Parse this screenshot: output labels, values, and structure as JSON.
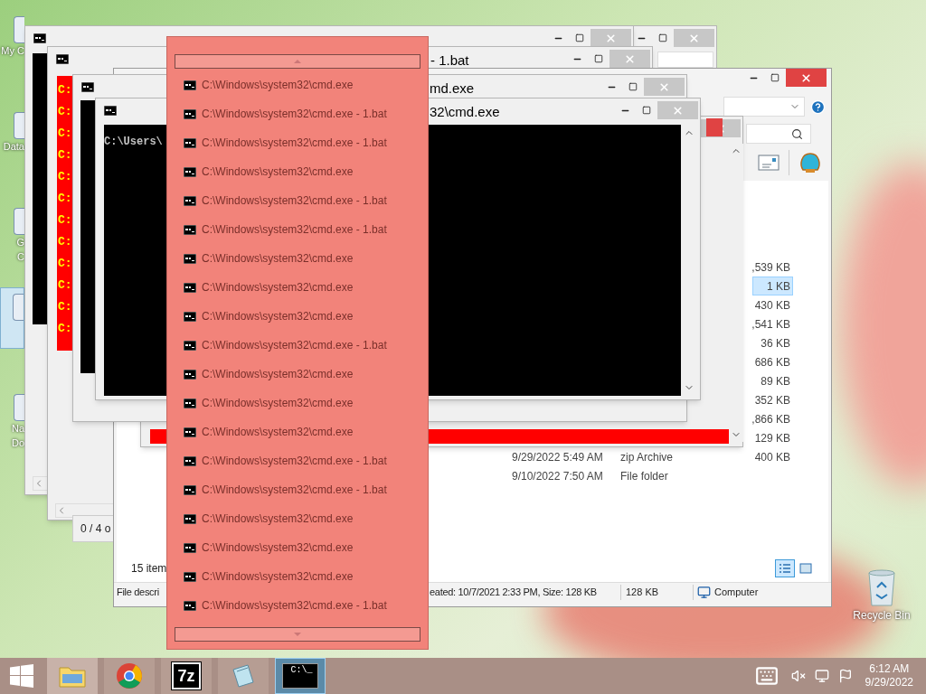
{
  "desktop_icons": [
    {
      "lines": [
        "My C"
      ],
      "selected": false
    },
    {
      "lines": [
        "Data"
      ],
      "selected": false
    },
    {
      "lines": [
        "G",
        "C"
      ],
      "selected": false
    },
    {
      "selected": true
    },
    {
      "lines": [
        "Na",
        "Do"
      ],
      "selected": false
    }
  ],
  "recycle_bin": {
    "label": "Recycle Bin"
  },
  "cmd_windows": [
    {
      "color": "#000000"
    },
    {
      "title": "- 1.bat",
      "color": "#ff0000",
      "lines": [
        "C:",
        "C:",
        "C:",
        "C:",
        "C:",
        "C:",
        "C:",
        "C:",
        "C:",
        "C:",
        "C:",
        "C:"
      ]
    },
    {
      "color": "#ff0000"
    },
    {
      "title": "md.exe",
      "color": "#000000"
    },
    {
      "title": "32\\cmd.exe",
      "color": "#000000",
      "lines": [
        "C:\\Users\\"
      ]
    }
  ],
  "status_window": {
    "text": "0 / 4 o"
  },
  "explorer": {
    "rows": [
      {
        "size": ",539 KB",
        "selected": false
      },
      {
        "size": "1 KB",
        "selected": true
      },
      {
        "size": "430 KB",
        "selected": false
      },
      {
        "size": ",541 KB",
        "selected": false
      },
      {
        "size": "36 KB",
        "selected": false
      },
      {
        "size": "686 KB",
        "selected": false
      },
      {
        "size": "89 KB",
        "selected": false
      },
      {
        "size": "352 KB",
        "selected": false
      },
      {
        "size": ",866 KB",
        "selected": false
      },
      {
        "size": "129 KB",
        "selected": false
      },
      {
        "date": "9/29/2022 5:49 AM",
        "type": "zip Archive",
        "size": "400 KB",
        "selected": false
      },
      {
        "date": "9/10/2022 7:50 AM",
        "type": "File folder",
        "selected": false
      }
    ],
    "item_count": "15 item",
    "views": [
      {
        "kind": "details",
        "selected": true
      },
      {
        "kind": "preview",
        "selected": false
      }
    ],
    "status_bar": [
      "File descri",
      "eated: 10/7/2021 2:33 PM, Size: 128 KB",
      "128 KB",
      "Computer"
    ]
  },
  "switcher": {
    "items": [
      {
        "label": "C:\\Windows\\system32\\cmd.exe"
      },
      {
        "label": "C:\\Windows\\system32\\cmd.exe - 1.bat"
      },
      {
        "label": "C:\\Windows\\system32\\cmd.exe - 1.bat"
      },
      {
        "label": "C:\\Windows\\system32\\cmd.exe"
      },
      {
        "label": "C:\\Windows\\system32\\cmd.exe - 1.bat"
      },
      {
        "label": "C:\\Windows\\system32\\cmd.exe - 1.bat"
      },
      {
        "label": "C:\\Windows\\system32\\cmd.exe"
      },
      {
        "label": "C:\\Windows\\system32\\cmd.exe"
      },
      {
        "label": "C:\\Windows\\system32\\cmd.exe"
      },
      {
        "label": "C:\\Windows\\system32\\cmd.exe - 1.bat"
      },
      {
        "label": "C:\\Windows\\system32\\cmd.exe"
      },
      {
        "label": "C:\\Windows\\system32\\cmd.exe"
      },
      {
        "label": "C:\\Windows\\system32\\cmd.exe"
      },
      {
        "label": "C:\\Windows\\system32\\cmd.exe - 1.bat"
      },
      {
        "label": "C:\\Windows\\system32\\cmd.exe - 1.bat"
      },
      {
        "label": "C:\\Windows\\system32\\cmd.exe"
      },
      {
        "label": "C:\\Windows\\system32\\cmd.exe"
      },
      {
        "label": "C:\\Windows\\system32\\cmd.exe"
      },
      {
        "label": "C:\\Windows\\system32\\cmd.exe - 1.bat"
      }
    ]
  },
  "taskbar": {
    "apps": [
      {
        "kind": "explorer",
        "active": true
      },
      {
        "kind": "chrome",
        "active": false
      },
      {
        "kind": "sevenzip",
        "label": "7z",
        "active": false
      },
      {
        "kind": "notepad",
        "active": false
      },
      {
        "kind": "cmd",
        "label": "C:\\_",
        "active": true
      }
    ],
    "clock": {
      "time": "6:12 AM",
      "date": "9/29/2022"
    }
  }
}
